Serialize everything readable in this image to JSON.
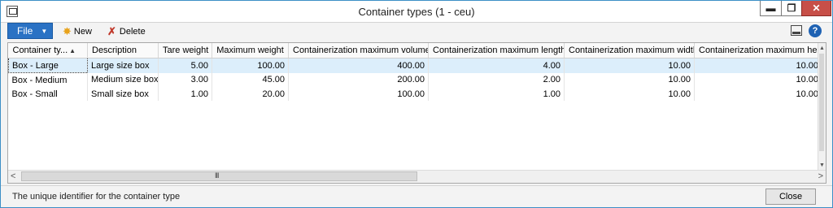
{
  "window": {
    "title": "Container types (1 - ceu)",
    "min_glyph": "▬",
    "max_glyph": "❐",
    "close_glyph": "✕"
  },
  "toolbar": {
    "file_label": "File",
    "new_label": "New",
    "delete_label": "Delete",
    "help_glyph": "?"
  },
  "grid": {
    "columns": [
      "Container ty...",
      "Description",
      "Tare weight",
      "Maximum weight",
      "Containerization maximum volume",
      "Containerization maximum length",
      "Containerization maximum width",
      "Containerization maximum height"
    ],
    "rows": [
      [
        "Box - Large",
        "Large size box",
        "5.00",
        "100.00",
        "400.00",
        "4.00",
        "10.00",
        "10.00"
      ],
      [
        "Box - Medium",
        "Medium size box",
        "3.00",
        "45.00",
        "200.00",
        "2.00",
        "10.00",
        "10.00"
      ],
      [
        "Box - Small",
        "Small size box",
        "1.00",
        "20.00",
        "100.00",
        "1.00",
        "10.00",
        "10.00"
      ]
    ],
    "hscroll_grip": "III"
  },
  "status": {
    "text": "The unique identifier for the container type",
    "close_label": "Close"
  },
  "colors": {
    "accent": "#2a72c4",
    "selected_row": "#dceefb",
    "window_close": "#c74f48"
  }
}
